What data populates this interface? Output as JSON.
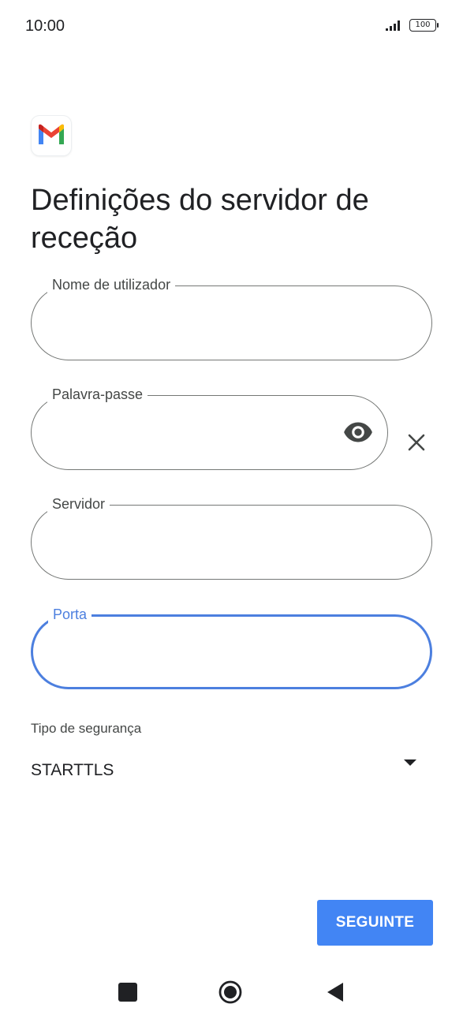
{
  "status_bar": {
    "time": "10:00",
    "battery": "100"
  },
  "page": {
    "title": "Definições do servidor de receção"
  },
  "fields": {
    "username": {
      "label": "Nome de utilizador",
      "value": ""
    },
    "password": {
      "label": "Palavra-passe",
      "value": ""
    },
    "server": {
      "label": "Servidor",
      "value": ""
    },
    "port": {
      "label": "Porta",
      "value": ""
    }
  },
  "security": {
    "label": "Tipo de segurança",
    "value": "STARTTLS"
  },
  "actions": {
    "next_label": "SEGUINTE"
  },
  "icons": {
    "app_logo": "gmail-logo-icon",
    "password_toggle": "eye-icon",
    "clear": "close-icon",
    "dropdown": "triangle-down-icon",
    "nav_recents": "square-icon",
    "nav_home": "circle-icon",
    "nav_back": "triangle-left-icon"
  },
  "colors": {
    "accent": "#4285f4",
    "focus": "#4c7fdf",
    "outline": "#747775"
  }
}
